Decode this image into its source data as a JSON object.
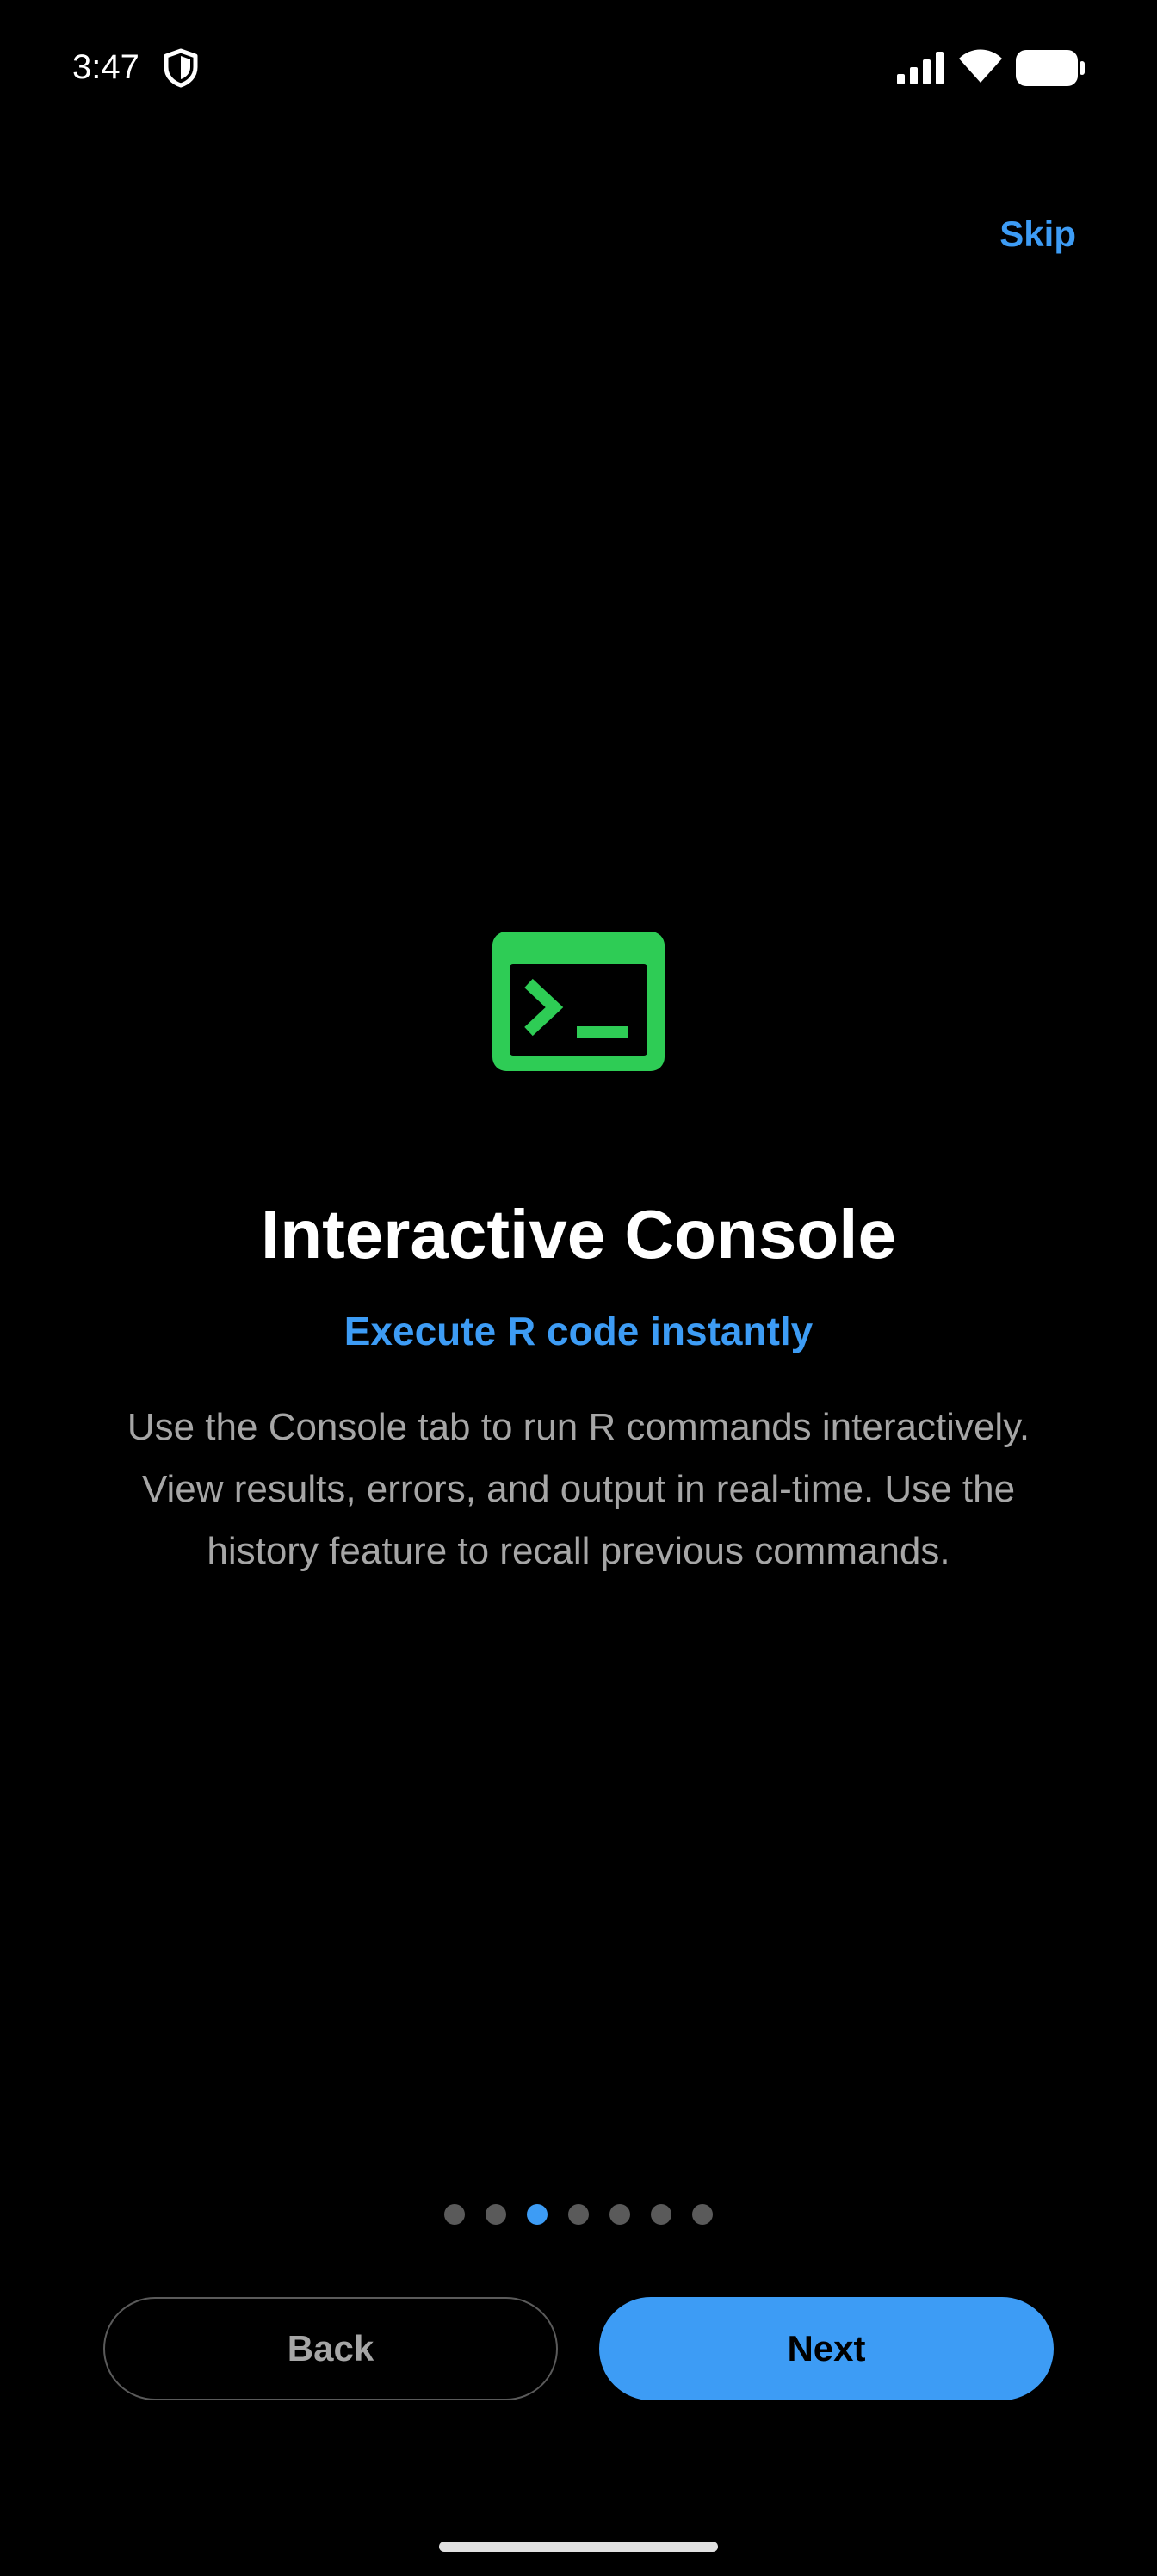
{
  "status_bar": {
    "time": "3:47",
    "icons": [
      "shield-icon",
      "signal-icon",
      "wifi-icon",
      "battery-icon"
    ]
  },
  "onboarding": {
    "skip_label": "Skip",
    "icon": "terminal-icon",
    "title": "Interactive Console",
    "subtitle": "Execute R code instantly",
    "description": "Use the Console tab to run R commands interactively. View results, errors, and output in real-time. Use the history feature to recall previous commands.",
    "page_count": 7,
    "current_page": 3
  },
  "buttons": {
    "back_label": "Back",
    "next_label": "Next"
  },
  "colors": {
    "background": "#000000",
    "accent": "#3d9cf5",
    "icon_green": "#2ecc55",
    "muted_text": "#a6a6a6",
    "inactive_dot": "#5a5a5a"
  }
}
